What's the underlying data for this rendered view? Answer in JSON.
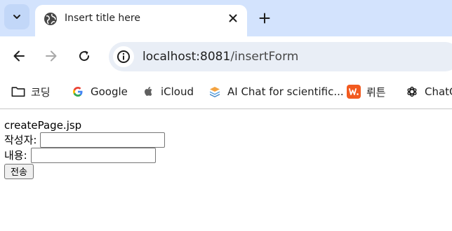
{
  "browser": {
    "tab": {
      "title": "Insert title here"
    },
    "address": {
      "host": "localhost:8081",
      "path": "/insertForm"
    },
    "bookmarks": [
      {
        "label": "코딩",
        "icon": "folder-icon"
      },
      {
        "label": "Google",
        "icon": "google-icon"
      },
      {
        "label": "iCloud",
        "icon": "apple-icon"
      },
      {
        "label": "AI Chat for scientific...",
        "icon": "scispace-icon"
      },
      {
        "label": "뤼튼",
        "icon": "wrtn-icon"
      },
      {
        "label": "ChatG",
        "icon": "openai-icon"
      }
    ]
  },
  "page": {
    "heading": "createPage.jsp",
    "fields": [
      {
        "label": "작성자:",
        "value": ""
      },
      {
        "label": "내용:",
        "value": ""
      }
    ],
    "submit_label": "전송"
  },
  "colors": {
    "tabstrip_bg": "#d3e3fd",
    "omnibox_bg": "#e9eef6",
    "wrtn_brand": "#f25a1f"
  }
}
